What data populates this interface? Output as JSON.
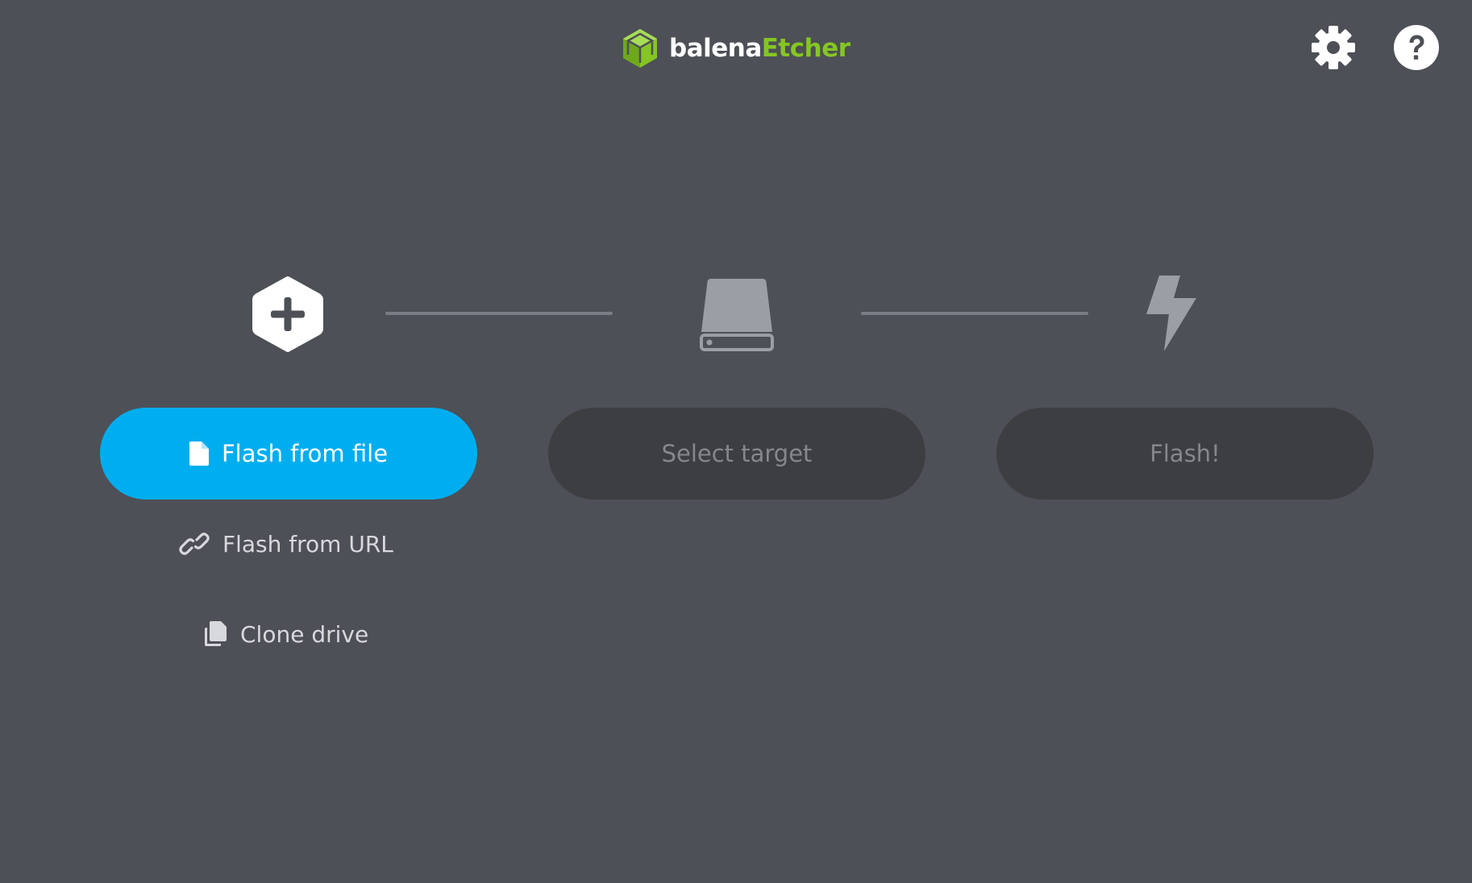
{
  "header": {
    "logo": {
      "brand_first": "balena",
      "brand_second": "Etcher",
      "icon": "balena-cube-icon",
      "colors": {
        "brand_first": "#ffffff",
        "brand_second": "#85c623"
      }
    },
    "settings_icon": "gear-icon",
    "help_icon": "question-mark-icon"
  },
  "steps": {
    "source": {
      "icon": "hexagon-plus-icon",
      "button_label": "Flash from file",
      "button_icon": "file-icon"
    },
    "target": {
      "icon": "drive-icon",
      "button_label": "Select target"
    },
    "flash": {
      "icon": "lightning-bolt-icon",
      "button_label": "Flash!"
    }
  },
  "source_options": {
    "url": {
      "label": "Flash from URL",
      "icon": "link-icon"
    },
    "clone": {
      "label": "Clone drive",
      "icon": "copy-icon"
    }
  },
  "colors": {
    "background": "#4d5057",
    "primary": "#00aeef",
    "disabled_bg": "#3c3e42",
    "disabled_text": "#84878d",
    "connector": "#787c84"
  }
}
